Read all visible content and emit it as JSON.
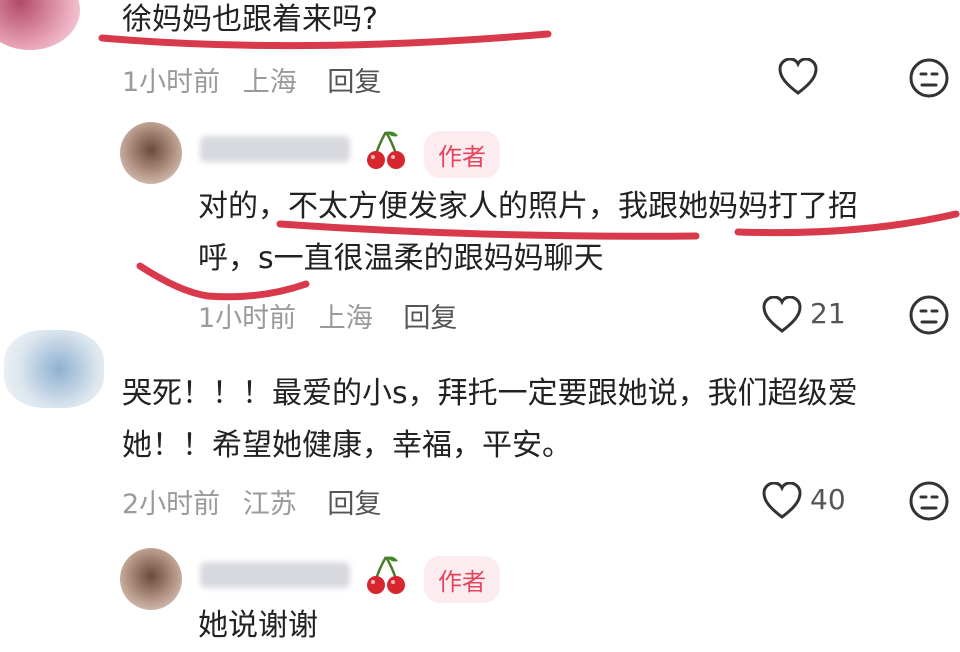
{
  "comments": [
    {
      "text_lines": [
        "徐妈妈也跟着来吗?"
      ],
      "time": "1小时前",
      "location": "上海",
      "reply_label": "回复",
      "likes": ""
    },
    {
      "badge": "作者",
      "text_lines": [
        "对的，不太方便发家人的照片，我跟她妈妈打了招",
        "呼，s一直很温柔的跟妈妈聊天"
      ],
      "time": "1小时前",
      "location": "上海",
      "reply_label": "回复",
      "likes": "21"
    },
    {
      "text_lines": [
        "哭死！！！最爱的小s，拜托一定要跟她说，我们超级爱",
        "她！！希望她健康，幸福，平安。"
      ],
      "time": "2小时前",
      "location": "江苏",
      "reply_label": "回复",
      "likes": "40"
    },
    {
      "badge": "作者",
      "text_lines": [
        "她说谢谢"
      ]
    }
  ],
  "icons": {
    "heart": "heart-icon",
    "emoji": "emoji-icon",
    "cherry": "cherry-icon"
  },
  "colors": {
    "annotation_red": "#d83a4b",
    "badge_bg": "#fdecef",
    "badge_text": "#e2455c",
    "meta_gray": "#9a9a9a"
  }
}
